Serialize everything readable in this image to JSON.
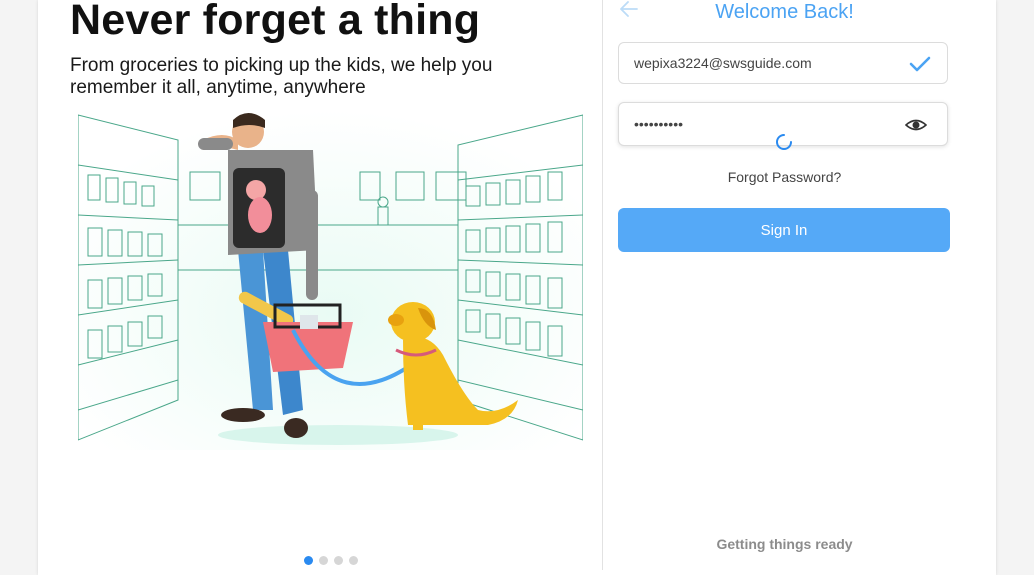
{
  "hero": {
    "title": "Never forget a thing",
    "subtitle": "From groceries to picking up the kids, we help you remember it all, anytime, anywhere",
    "illustration": "grocery-store-dad-with-baby-and-dog-illustration"
  },
  "carousel": {
    "total_slides": 4,
    "active_slide": 1
  },
  "login": {
    "title": "Welcome Back!",
    "email_value": "wepixa3224@swsguide.com",
    "password_value": "••••••••••",
    "forgot_label": "Forgot Password?",
    "signin_label": "Sign In",
    "status_text": "Getting things ready"
  },
  "icons": {
    "back": "arrow-left-icon",
    "email_valid": "check-icon",
    "show_password": "eye-icon",
    "loading": "spinner-icon"
  },
  "colors": {
    "accent": "#4ba3f3",
    "button": "#55a9f7",
    "dot_active": "#2a8af0",
    "dot_inactive": "#d6d6d6",
    "status_text": "#8c8c8c",
    "illustration_lines": "#4aa78a",
    "basket": "#f0737a",
    "dog": "#f5c020",
    "leash": "#4aa3f0"
  }
}
